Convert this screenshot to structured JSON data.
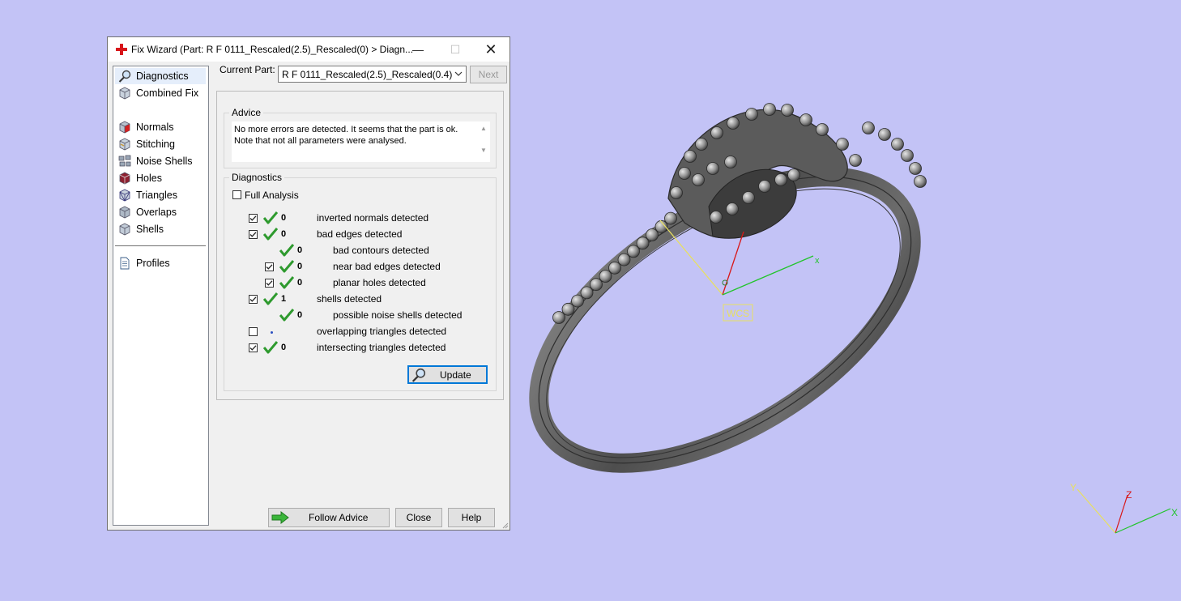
{
  "viewport": {
    "background": "#c3c3f6",
    "wcs_label": "WCS",
    "axis_x": "x",
    "mini_axis_x": "X",
    "mini_axis_y": "Y",
    "mini_axis_z": "Z"
  },
  "dialog": {
    "title": "Fix Wizard (Part: R F 0111_Rescaled(2.5)_Rescaled(0) > Diagn...",
    "title_icon": "red-cross-icon",
    "minimize": "—",
    "maximize": "☐",
    "close": "✕",
    "sidebar": {
      "items": [
        {
          "label": "Diagnostics",
          "icon": "magnifier-icon"
        },
        {
          "label": "Combined Fix",
          "icon": "cube-icon"
        },
        {
          "label": "Normals",
          "icon": "normals-cube-icon"
        },
        {
          "label": "Stitching",
          "icon": "stitching-cube-icon"
        },
        {
          "label": "Noise Shells",
          "icon": "noise-shells-icon"
        },
        {
          "label": "Holes",
          "icon": "holes-cube-icon"
        },
        {
          "label": "Triangles",
          "icon": "triangles-cube-icon"
        },
        {
          "label": "Overlaps",
          "icon": "overlaps-cube-icon"
        },
        {
          "label": "Shells",
          "icon": "shells-cube-icon"
        },
        {
          "label": "Profiles",
          "icon": "profiles-doc-icon"
        }
      ]
    },
    "current_part": {
      "label": "Current Part:",
      "value": "R F 0111_Rescaled(2.5)_Rescaled(0.4)",
      "next_label": "Next"
    },
    "advice": {
      "title": "Advice",
      "line1": "No more errors are detected. It seems that the part is ok.",
      "line2": "Note that not all parameters were analysed."
    },
    "diagnostics": {
      "title": "Diagnostics",
      "full_analysis_label": "Full Analysis",
      "full_analysis_checked": false,
      "rows": [
        {
          "label": "inverted normals detected",
          "count": "0",
          "checked": true,
          "has_checkbox": true,
          "status": "ok"
        },
        {
          "label": "bad edges detected",
          "count": "0",
          "checked": true,
          "has_checkbox": true,
          "status": "ok"
        },
        {
          "label": "bad contours detected",
          "count": "0",
          "checked": false,
          "has_checkbox": false,
          "status": "ok"
        },
        {
          "label": "near bad edges detected",
          "count": "0",
          "checked": true,
          "has_checkbox": true,
          "status": "ok"
        },
        {
          "label": "planar holes detected",
          "count": "0",
          "checked": true,
          "has_checkbox": true,
          "status": "ok"
        },
        {
          "label": "shells detected",
          "count": "1",
          "checked": true,
          "has_checkbox": true,
          "status": "ok"
        },
        {
          "label": "possible noise shells detected",
          "count": "0",
          "checked": false,
          "has_checkbox": false,
          "status": "ok"
        },
        {
          "label": "overlapping triangles detected",
          "count": "",
          "checked": false,
          "has_checkbox": true,
          "status": "none"
        },
        {
          "label": "intersecting triangles detected",
          "count": "0",
          "checked": true,
          "has_checkbox": true,
          "status": "ok"
        }
      ],
      "update_label": "Update"
    },
    "footer": {
      "follow_advice_label": "Follow Advice",
      "close_label": "Close",
      "help_label": "Help"
    }
  }
}
